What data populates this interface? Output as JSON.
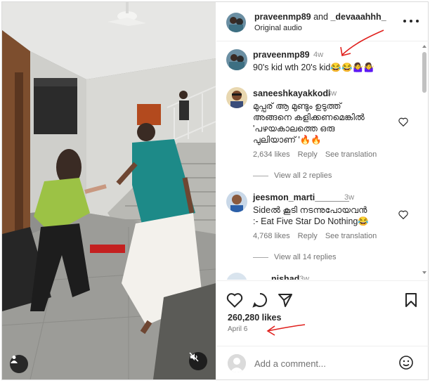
{
  "post": {
    "header": {
      "author": "praveenmp89",
      "and_text": "and",
      "collaborator": "_devaaahhh_",
      "audio": "Original audio"
    },
    "caption": {
      "user": "praveenmp89",
      "time": "4w",
      "text": "90's kid wth 20's kid😂😂🤷‍♀️🤷‍♀️"
    },
    "comments": [
      {
        "user": "saneeshkayakkodi",
        "time": "3w",
        "lines": [
          "മുപ്പര് ആ മുണ്ടും ഉടുത്ത്",
          "അങ്ങനെ കളിക്കണമെങ്കിൽ",
          "'പഴയകാലത്തെ ഒരു",
          "പുലിയാണ് '🔥🔥"
        ],
        "likes": "2,634 likes",
        "reply": "Reply",
        "translation": "See translation",
        "view_replies": "View all 2 replies"
      },
      {
        "user": "jeesmon_marti_______",
        "time": "3w",
        "lines": [
          "Sideൽ കൂടി നടന്നുപോയവൻ",
          ":- Eat Five Star Do Nothing😂"
        ],
        "likes": "4,768 likes",
        "reply": "Reply",
        "translation": "See translation",
        "view_replies": "View all 14 replies"
      },
      {
        "user": "nishad",
        "time": "3w"
      }
    ],
    "likes_count": "260,280 likes",
    "date": "April 6",
    "add_comment_placeholder": "Add a comment...",
    "icons": [
      "heart-icon",
      "comment-icon",
      "share-icon",
      "bookmark-icon",
      "emoji-icon",
      "more-icon",
      "user-tag-icon",
      "muted-icon"
    ],
    "colors": {
      "annotation_red": "#e0201d",
      "text_primary": "#262626",
      "text_secondary": "#737373"
    }
  }
}
